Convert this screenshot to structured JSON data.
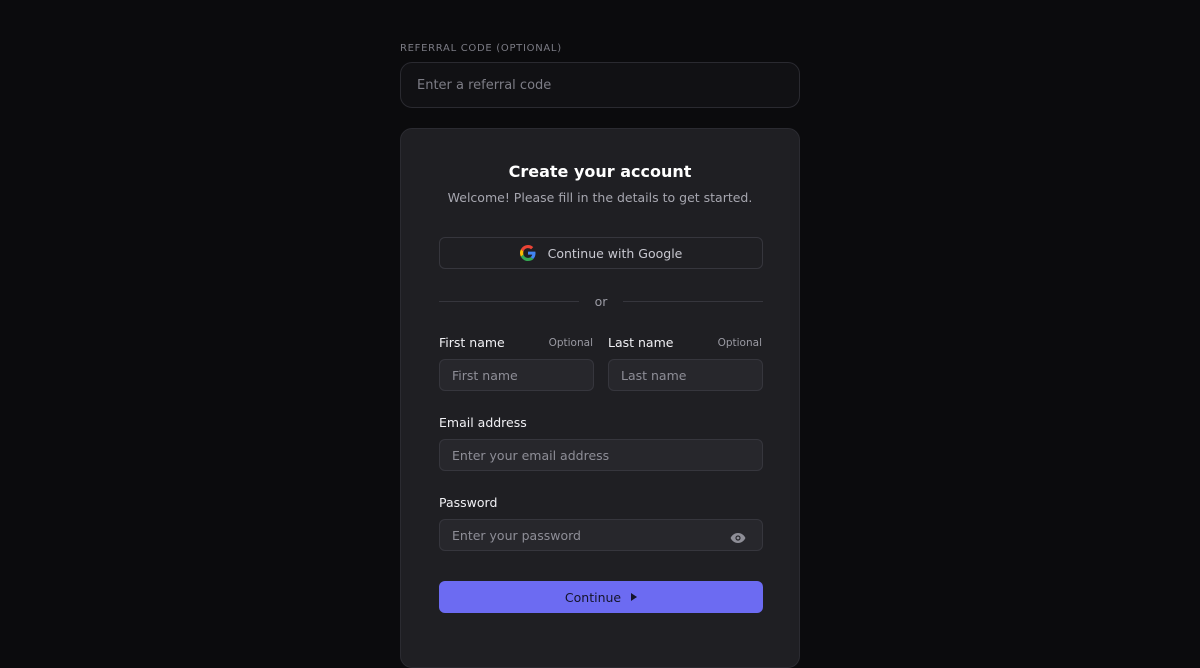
{
  "referral": {
    "label": "REFERRAL CODE (OPTIONAL)",
    "placeholder": "Enter a referral code"
  },
  "card": {
    "title": "Create your account",
    "subtitle": "Welcome! Please fill in the details to get started.",
    "google_button": {
      "label": "Continue with Google",
      "icon": "google-icon"
    },
    "divider_text": "or",
    "first_name": {
      "label": "First name",
      "optional": "Optional",
      "placeholder": "First name"
    },
    "last_name": {
      "label": "Last name",
      "optional": "Optional",
      "placeholder": "Last name"
    },
    "email": {
      "label": "Email address",
      "placeholder": "Enter your email address"
    },
    "password": {
      "label": "Password",
      "placeholder": "Enter your password",
      "toggle_icon": "eye-icon"
    },
    "continue_button": {
      "label": "Continue",
      "icon": "caret-right-icon"
    }
  },
  "colors": {
    "background": "#0b0b0d",
    "card": "#1f1f23",
    "accent": "#6c6bf2"
  }
}
